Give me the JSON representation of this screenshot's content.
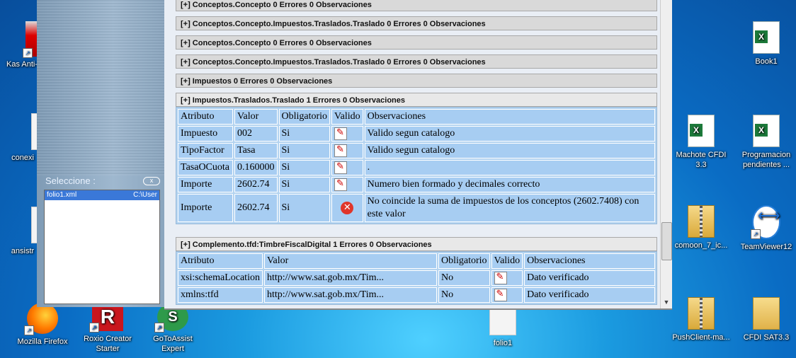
{
  "desktop": {
    "left_icons": [
      {
        "label": "Kas Anti-R",
        "icon": "kaspersky-icon"
      },
      {
        "label": "conexi",
        "icon": "file-icon"
      },
      {
        "label": "ansistr",
        "icon": "file-icon"
      }
    ],
    "bottom_icons": [
      {
        "label": "Mozilla Firefox",
        "icon": "firefox-icon"
      },
      {
        "label": "Roxio Creator Starter",
        "icon": "roxio-icon"
      },
      {
        "label": "GoToAssist Expert",
        "icon": "gotoassist-icon"
      },
      {
        "label": "folio1",
        "icon": "document-icon"
      }
    ],
    "right_icons": [
      {
        "label": "Book1",
        "icon": "excel-icon"
      },
      {
        "label": "Machote CFDI 3.3",
        "icon": "excel-icon"
      },
      {
        "label": "Programacion pendientes ...",
        "icon": "excel-icon"
      },
      {
        "label": "comoon_7_ic...",
        "icon": "zip-folder-icon"
      },
      {
        "label": "TeamViewer12",
        "icon": "teamviewer-icon"
      },
      {
        "label": "PushClient-ma...",
        "icon": "zip-folder-icon"
      },
      {
        "label": "CFDI SAT3.3",
        "icon": "folder-icon"
      }
    ]
  },
  "left_panel": {
    "select_label": "Seleccione :",
    "close_button": "x",
    "file": {
      "name": "folio1.xml",
      "path": "C:\\User"
    }
  },
  "sections": [
    {
      "title": "[+] Conceptos.Concepto   0 Errores   0 Observaciones"
    },
    {
      "title": "[+] Conceptos.Concepto.Impuestos.Traslados.Traslado   0 Errores   0 Observaciones"
    },
    {
      "title": "[+] Conceptos.Concepto   0 Errores   0 Observaciones"
    },
    {
      "title": "[+] Conceptos.Concepto.Impuestos.Traslados.Traslado   0 Errores   0 Observaciones"
    },
    {
      "title": "[+] Impuestos   0 Errores   0 Observaciones"
    },
    {
      "title": "[+] Impuestos.Traslados.Traslado   1 Errores   0 Observaciones"
    },
    {
      "title": "[+] Complemento.tfd:TimbreFiscalDigital   1 Errores   0 Observaciones"
    }
  ],
  "table1": {
    "headers": [
      "Atributo",
      "Valor",
      "Obligatorio",
      "Valido",
      "Observaciones"
    ],
    "rows": [
      {
        "attr": "Impuesto",
        "value": "002",
        "req": "Si",
        "valid": "ok",
        "obs": "Valido segun catalogo"
      },
      {
        "attr": "TipoFactor",
        "value": "Tasa",
        "req": "Si",
        "valid": "ok",
        "obs": "Valido segun catalogo"
      },
      {
        "attr": "TasaOCuota",
        "value": "0.160000",
        "req": "Si",
        "valid": "ok",
        "obs": "."
      },
      {
        "attr": "Importe",
        "value": "2602.74",
        "req": "Si",
        "valid": "ok",
        "obs": "Numero bien formado y decimales correcto"
      },
      {
        "attr": "Importe",
        "value": "2602.74",
        "req": "Si",
        "valid": "error",
        "obs": "No coincide la suma de impuestos de los conceptos (2602.7408) con este valor"
      }
    ]
  },
  "table2": {
    "headers": [
      "Atributo",
      "Valor",
      "Obligatorio",
      "Valido",
      "Observaciones"
    ],
    "rows": [
      {
        "attr": "xsi:schemaLocation",
        "value": "http://www.sat.gob.mx/Tim...",
        "req": "No",
        "valid": "ok",
        "obs": "Dato verificado"
      },
      {
        "attr": "xmlns:tfd",
        "value": "http://www.sat.gob.mx/Tim...",
        "req": "No",
        "valid": "ok",
        "obs": "Dato verificado"
      }
    ]
  }
}
